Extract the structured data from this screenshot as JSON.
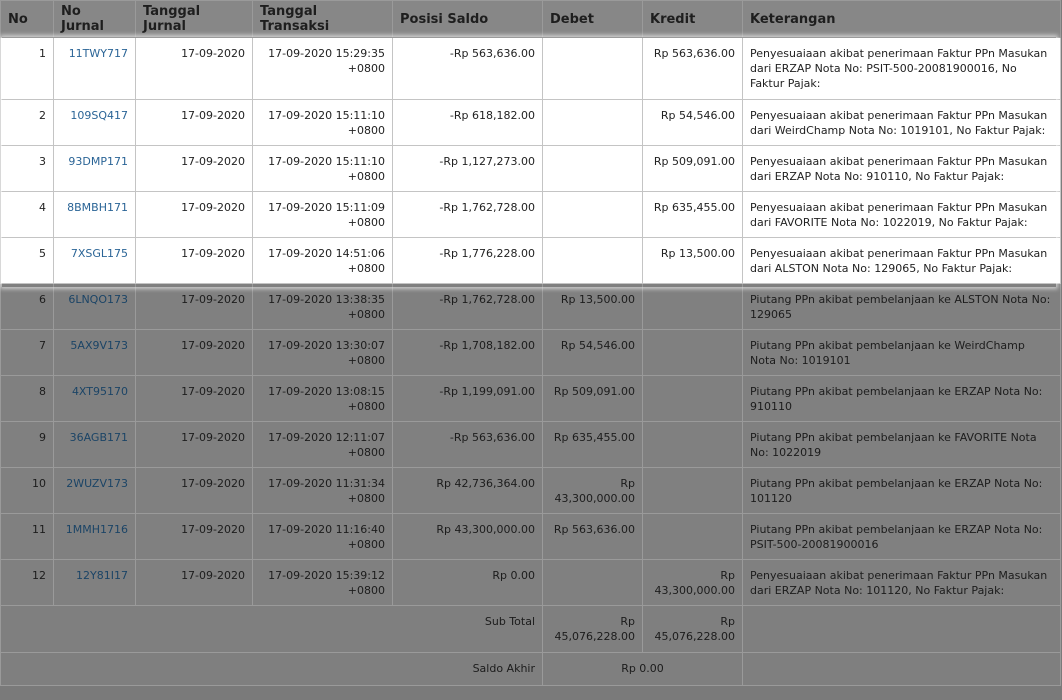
{
  "columns": [
    "No",
    "No Jurnal",
    "Tanggal Jurnal",
    "Tanggal Transaksi",
    "Posisi Saldo",
    "Debet",
    "Kredit",
    "Keterangan"
  ],
  "rows": [
    {
      "no": "1",
      "jurnal": "11TWY717",
      "tgl_jurnal": "17-09-2020",
      "tgl_transaksi": "17-09-2020 15:29:35 +0800",
      "saldo": "-Rp 563,636.00",
      "debet": "",
      "kredit": "Rp 563,636.00",
      "keterangan": "Penyesuaiaan akibat penerimaan Faktur PPn Masukan dari ERZAP Nota No: PSIT-500-20081900016, No Faktur Pajak:"
    },
    {
      "no": "2",
      "jurnal": "109SQ417",
      "tgl_jurnal": "17-09-2020",
      "tgl_transaksi": "17-09-2020 15:11:10 +0800",
      "saldo": "-Rp 618,182.00",
      "debet": "",
      "kredit": "Rp 54,546.00",
      "keterangan": "Penyesuaiaan akibat penerimaan Faktur PPn Masukan dari WeirdChamp Nota No: 1019101, No Faktur Pajak:"
    },
    {
      "no": "3",
      "jurnal": "93DMP171",
      "tgl_jurnal": "17-09-2020",
      "tgl_transaksi": "17-09-2020 15:11:10 +0800",
      "saldo": "-Rp 1,127,273.00",
      "debet": "",
      "kredit": "Rp 509,091.00",
      "keterangan": "Penyesuaiaan akibat penerimaan Faktur PPn Masukan dari ERZAP Nota No: 910110, No Faktur Pajak:"
    },
    {
      "no": "4",
      "jurnal": "8BMBH171",
      "tgl_jurnal": "17-09-2020",
      "tgl_transaksi": "17-09-2020 15:11:09 +0800",
      "saldo": "-Rp 1,762,728.00",
      "debet": "",
      "kredit": "Rp 635,455.00",
      "keterangan": "Penyesuaiaan akibat penerimaan Faktur PPn Masukan dari FAVORITE Nota No: 1022019, No Faktur Pajak:"
    },
    {
      "no": "5",
      "jurnal": "7XSGL175",
      "tgl_jurnal": "17-09-2020",
      "tgl_transaksi": "17-09-2020 14:51:06 +0800",
      "saldo": "-Rp 1,776,228.00",
      "debet": "",
      "kredit": "Rp 13,500.00",
      "keterangan": "Penyesuaiaan akibat penerimaan Faktur PPn Masukan dari ALSTON Nota No: 129065, No Faktur Pajak:"
    },
    {
      "no": "6",
      "jurnal": "6LNQO173",
      "tgl_jurnal": "17-09-2020",
      "tgl_transaksi": "17-09-2020 13:38:35 +0800",
      "saldo": "-Rp 1,762,728.00",
      "debet": "Rp 13,500.00",
      "kredit": "",
      "keterangan": "Piutang PPn akibat pembelanjaan ke ALSTON Nota No: 129065"
    },
    {
      "no": "7",
      "jurnal": "5AX9V173",
      "tgl_jurnal": "17-09-2020",
      "tgl_transaksi": "17-09-2020 13:30:07 +0800",
      "saldo": "-Rp 1,708,182.00",
      "debet": "Rp 54,546.00",
      "kredit": "",
      "keterangan": "Piutang PPn akibat pembelanjaan ke WeirdChamp Nota No: 1019101"
    },
    {
      "no": "8",
      "jurnal": "4XT95170",
      "tgl_jurnal": "17-09-2020",
      "tgl_transaksi": "17-09-2020 13:08:15 +0800",
      "saldo": "-Rp 1,199,091.00",
      "debet": "Rp 509,091.00",
      "kredit": "",
      "keterangan": "Piutang PPn akibat pembelanjaan ke ERZAP Nota No: 910110"
    },
    {
      "no": "9",
      "jurnal": "36AGB171",
      "tgl_jurnal": "17-09-2020",
      "tgl_transaksi": "17-09-2020 12:11:07 +0800",
      "saldo": "-Rp 563,636.00",
      "debet": "Rp 635,455.00",
      "kredit": "",
      "keterangan": "Piutang PPn akibat pembelanjaan ke FAVORITE Nota No: 1022019"
    },
    {
      "no": "10",
      "jurnal": "2WUZV173",
      "tgl_jurnal": "17-09-2020",
      "tgl_transaksi": "17-09-2020 11:31:34 +0800",
      "saldo": "Rp 42,736,364.00",
      "debet": "Rp 43,300,000.00",
      "kredit": "",
      "keterangan": "Piutang PPn akibat pembelanjaan ke ERZAP Nota No: 101120"
    },
    {
      "no": "11",
      "jurnal": "1MMH1716",
      "tgl_jurnal": "17-09-2020",
      "tgl_transaksi": "17-09-2020 11:16:40 +0800",
      "saldo": "Rp 43,300,000.00",
      "debet": "Rp 563,636.00",
      "kredit": "",
      "keterangan": "Piutang PPn akibat pembelanjaan ke ERZAP Nota No: PSIT-500-20081900016"
    },
    {
      "no": "12",
      "jurnal": "12Y81I17",
      "tgl_jurnal": "17-09-2020",
      "tgl_transaksi": "17-09-2020 15:39:12 +0800",
      "saldo": "Rp 0.00",
      "debet": "",
      "kredit": "Rp 43,300,000.00",
      "keterangan": "Penyesuaiaan akibat penerimaan Faktur PPn Masukan dari ERZAP Nota No: 101120, No Faktur Pajak:"
    }
  ],
  "footer": {
    "subtotal_label": "Sub Total",
    "subtotal_debet": "Rp 45,076,228.00",
    "subtotal_kredit": "Rp 45,076,228.00",
    "saldo_label": "Saldo Akhir",
    "saldo_value": "Rp 0.00"
  }
}
